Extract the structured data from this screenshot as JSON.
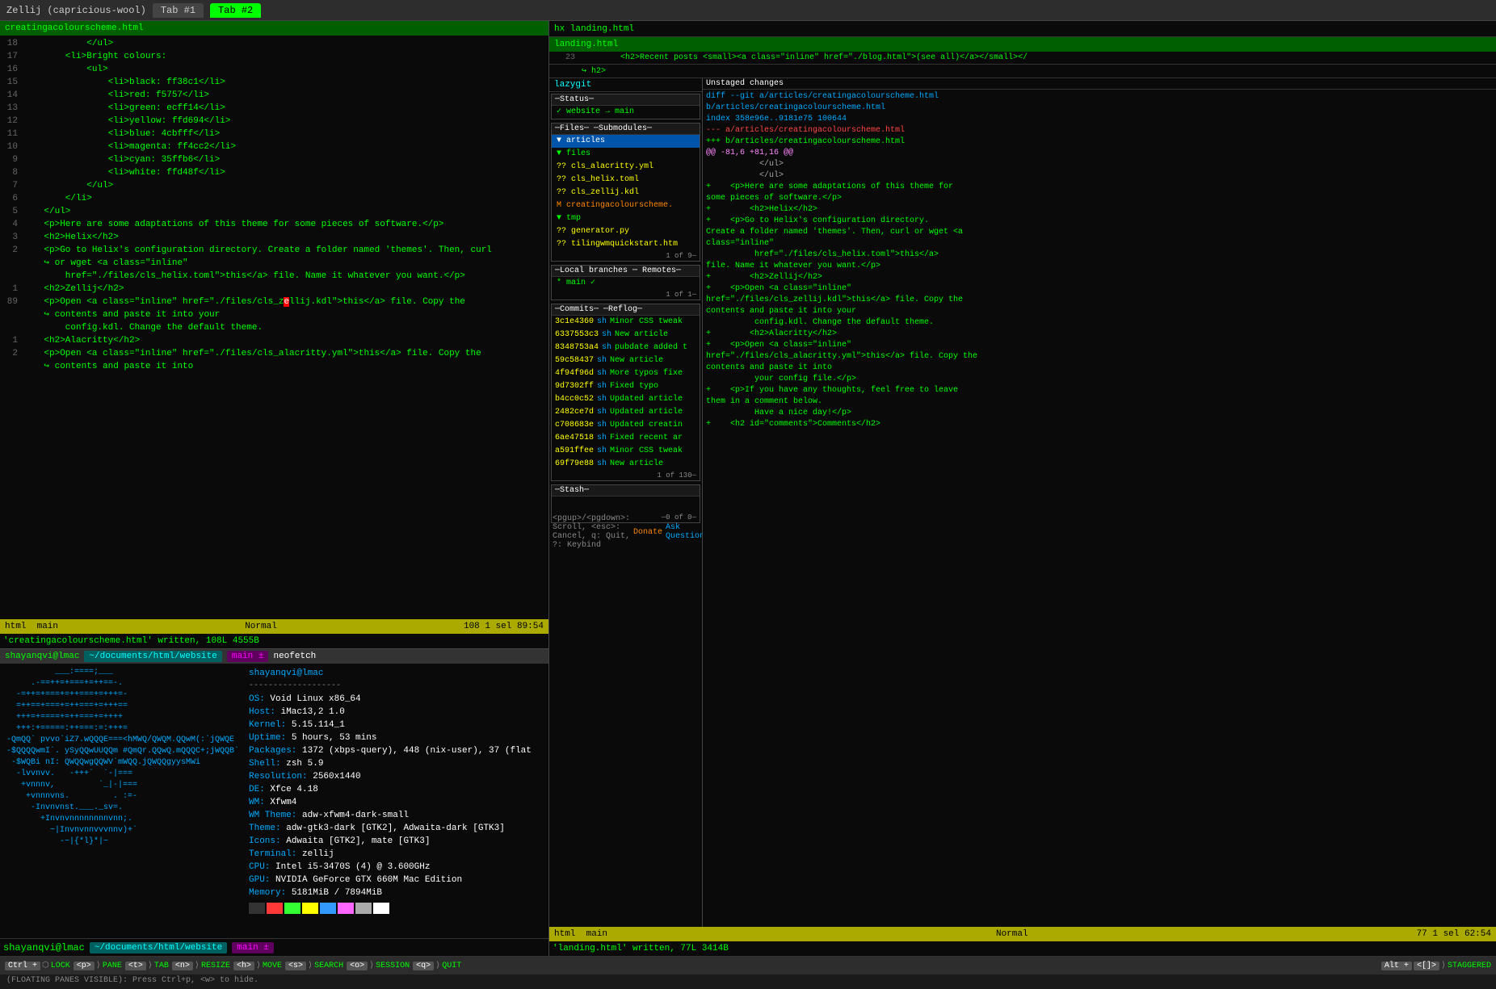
{
  "titleBar": {
    "title": "Zellij (capricious-wool)",
    "tab1": "Tab #1",
    "tab2": "Tab #2"
  },
  "leftEditor": {
    "filename": "creatingacolourscheme.html",
    "lines": [
      {
        "num": "18",
        "content": "            </ul>"
      },
      {
        "num": "17",
        "content": "        <li>Bright colours:"
      },
      {
        "num": "16",
        "content": "            <ul>"
      },
      {
        "num": "15",
        "content": "                <li>black: ff38c1</li>"
      },
      {
        "num": "14",
        "content": "                <li>red: f5757</li>"
      },
      {
        "num": "13",
        "content": "                <li>green: ecff14</li>"
      },
      {
        "num": "12",
        "content": "                <li>yellow: ffd694</li>"
      },
      {
        "num": "11",
        "content": "                <li>blue: 4cbfff</li>"
      },
      {
        "num": "10",
        "content": "                <li>magenta: ff4cc2</li>"
      },
      {
        "num": "9",
        "content": "                <li>cyan: 35ffb6</li>"
      },
      {
        "num": "8",
        "content": "                <li>white: ffd48f</li>"
      },
      {
        "num": "7",
        "content": "            </ul>"
      },
      {
        "num": "6",
        "content": "        </li>"
      },
      {
        "num": "5",
        "content": "    </ul>"
      },
      {
        "num": "4",
        "content": "    <p>Here are some adaptations of this theme for some pieces of software.</p>"
      },
      {
        "num": "3",
        "content": "    <h2>Helix</h2>"
      },
      {
        "num": "2",
        "content": "    <p>Go to Helix's configuration directory. Create a folder named 'themes'. Then, curl"
      },
      {
        "num": "",
        "content": "    ↪ or wget <a class=\"inline\""
      },
      {
        "num": "",
        "content": "        href=\"./files/cls_helix.toml\">this</a> file. Name it whatever you want.</p>"
      },
      {
        "num": "1",
        "content": "    <h2>Zellij</h2>"
      },
      {
        "num": "89",
        "content": "    <p>Open <a class=\"inline\" href=\"./files/cls_zellij.kdl\">this</a> file. Copy the"
      },
      {
        "num": "",
        "content": "    ↪ contents and paste it into your"
      },
      {
        "num": "",
        "content": "        config.kdl. Change the default theme."
      },
      {
        "num": "1",
        "content": "    <h2>Alacritty</h2>"
      },
      {
        "num": "2",
        "content": "    <p>Open <a class=\"inline\" href=\"./files/cls_alacritty.yml\">this</a> file. Copy the"
      },
      {
        "num": "",
        "content": "    ↪ contents and paste it into"
      }
    ],
    "statusbar": {
      "left": "html  main",
      "mode": "Normal",
      "right": "108  1 sel  89:54"
    },
    "cmdline": "'creatingacolourscheme.html' written, 108L 4555B"
  },
  "terminal": {
    "user": "shayanqvi@lmac",
    "path": "~/documents/html/website",
    "branch": "main ±",
    "command": "neofetch",
    "hostname": "shayanqvi@lmac",
    "info": {
      "os": "Void Linux x86_64",
      "host": "iMac13,2 1.0",
      "kernel": "5.15.114_1",
      "uptime": "5 hours, 53 mins",
      "packages": "1372 (xbps-query), 448 (nix-user), 37 (flat",
      "shell": "zsh 5.9",
      "resolution": "2560x1440",
      "de": "Xfce 4.18",
      "wm": "Xfwm4",
      "wm_theme": "adw-xfwm4-dark-small",
      "theme": "adw-gtk3-dark [GTK2], Adwaita-dark [GTK3]",
      "icons": "Adwaita [GTK2], mate [GTK3]",
      "terminal": "zellij",
      "cpu": "Intel i5-3470S (4) @ 3.600GHz",
      "gpu": "NVIDIA GeForce GTX 660M Mac Edition",
      "memory": "5181MiB / 7894MiB"
    },
    "swatches": [
      "#1a1a2e",
      "#333333",
      "#ff3838",
      "#33ff33",
      "#ffff00",
      "#3399ff",
      "#ff33ff",
      "#aaaaaa",
      "#ffffff"
    ]
  },
  "rightEditor": {
    "windowTitle": "hx landing.html",
    "filename": "landing.html",
    "headerLine": "      <h2>Recent posts <small><a class=\"inline\" href=\"./blog.html\">(see all)</a></small></",
    "lineNum": "23"
  },
  "lazygit": {
    "title": "lazygit",
    "statusSection": {
      "title": "Status",
      "item": "✓ website → main"
    },
    "filesSection": {
      "title": "Files",
      "submodulesTitle": "Submodules",
      "items": [
        {
          "name": "▼ articles",
          "selected": true
        },
        {
          "name": "  ▼ files",
          "type": "normal"
        },
        {
          "name": "    ?? cls_alacritty.yml",
          "type": "yellow"
        },
        {
          "name": "    ?? cls_helix.toml",
          "type": "yellow"
        },
        {
          "name": "    ?? cls_zellij.kdl",
          "type": "yellow"
        },
        {
          "name": "  M creatingacolourscheme.",
          "type": "modified"
        },
        {
          "name": "▼ tmp",
          "type": "normal"
        },
        {
          "name": "  ?? generator.py",
          "type": "yellow"
        },
        {
          "name": "  ?? tilingwmquickstart.htm",
          "type": "yellow"
        }
      ],
      "scrollIndicator": "1 of 9"
    },
    "branchesSection": {
      "title": "Local branches",
      "remotesTitle": "Remotes",
      "items": [
        {
          "name": "* main ✓",
          "selected": false
        }
      ],
      "scrollIndicator": "1 of 1"
    },
    "commitsSection": {
      "title": "Commits",
      "reflogTitle": "Reflog",
      "items": [
        {
          "hash": "3c1e4360",
          "author": "sh",
          "msg": "Minor CSS tweak"
        },
        {
          "hash": "6337553c3",
          "author": "sh",
          "msg": "New article"
        },
        {
          "hash": "8348753a4",
          "author": "sh",
          "msg": "pubdate added t"
        },
        {
          "hash": "59c58437",
          "author": "sh",
          "msg": "New article"
        },
        {
          "hash": "4f94f96d",
          "author": "sh",
          "msg": "More typos fixe"
        },
        {
          "hash": "9d7302ff",
          "author": "sh",
          "msg": "Fixed typo"
        },
        {
          "hash": "b4cc0c52",
          "author": "sh",
          "msg": "Updated article"
        },
        {
          "hash": "2482ce7d",
          "author": "sh",
          "msg": "Updated article"
        },
        {
          "hash": "c708683e",
          "author": "sh",
          "msg": "Updated creatin"
        },
        {
          "hash": "6ae47518",
          "author": "sh",
          "msg": "Fixed recent ar"
        },
        {
          "hash": "a591ffee",
          "author": "sh",
          "msg": "Minor CSS tweak"
        },
        {
          "hash": "69f79e88",
          "author": "sh",
          "msg": "New article"
        }
      ],
      "scrollIndicator": "1 of 130"
    },
    "stashSection": {
      "title": "Stash",
      "scrollIndicator": "0 of 0"
    }
  },
  "diffPanel": {
    "title": "Unstaged changes",
    "lines": [
      {
        "type": "meta",
        "text": "diff --git a/articles/creatingacolourscheme.html"
      },
      {
        "type": "meta",
        "text": "b/articles/creatingacolourscheme.html"
      },
      {
        "type": "meta",
        "text": "index 358e96e..9181e75 100644"
      },
      {
        "type": "removed",
        "text": "--- a/articles/creatingacolourscheme.html"
      },
      {
        "type": "added",
        "text": "+++ b/articles/creatingacolourscheme.html"
      },
      {
        "type": "header",
        "text": "@@ -81,6 +81,16 @@"
      },
      {
        "type": "normal",
        "text": "           </ul>"
      },
      {
        "type": "normal",
        "text": "           </ul>"
      },
      {
        "type": "added",
        "text": "+    <p>Here are some adaptations of this theme for"
      },
      {
        "type": "added",
        "text": "some pieces of software.</p>"
      },
      {
        "type": "added",
        "text": "+        <h2>Helix</h2>"
      },
      {
        "type": "added",
        "text": "+    <p>Go to Helix's configuration directory."
      },
      {
        "type": "added",
        "text": "Create a folder named 'themes'. Then, curl or wget <a"
      },
      {
        "type": "added",
        "text": "class=\"inline\""
      },
      {
        "type": "added",
        "text": "          href=\"./files/cls_helix.toml\">this</a>"
      },
      {
        "type": "added",
        "text": "file. Name it whatever you want.</p>"
      },
      {
        "type": "added",
        "text": "+        <h2>Zellij</h2>"
      },
      {
        "type": "added",
        "text": "+    <p>Open <a class=\"inline\""
      },
      {
        "type": "added",
        "text": "href=\"./files/cls_zellij.kdl\">this</a> file. Copy the"
      },
      {
        "type": "added",
        "text": "contents and paste it into your"
      },
      {
        "type": "added",
        "text": "          config.kdl. Change the default theme."
      },
      {
        "type": "added",
        "text": "+        <h2>Alacritty</h2>"
      },
      {
        "type": "added",
        "text": "+    <p>Open <a class=\"inline\""
      },
      {
        "type": "added",
        "text": "href=\"./files/cls_alacritty.yml\">this</a> file. Copy the"
      },
      {
        "type": "added",
        "text": "contents and paste it into"
      },
      {
        "type": "added",
        "text": "          your config file.</p>"
      },
      {
        "type": "added",
        "text": "+    <p>If you have any thoughts, feel free to leave"
      },
      {
        "type": "added",
        "text": "them in a comment below."
      },
      {
        "type": "added",
        "text": "          Have a nice day!</p>"
      },
      {
        "type": "added",
        "text": "+    <h2 id=\"comments\">Comments</h2>"
      }
    ]
  },
  "rightStatusbar": {
    "left": "html  main",
    "mode": "Normal",
    "right": "77  1 sel  62:54"
  },
  "rightCmdline": "'landing.html' written, 77L 3414B",
  "keybinds": [
    {
      "key": "Ctrl +",
      "arrow": "⬡",
      "label": "LOCK"
    },
    {
      "key": "<p>",
      "arrow": "⟩",
      "label": "PANE"
    },
    {
      "key": "<t>",
      "arrow": "⟩",
      "label": "TAB"
    },
    {
      "key": "<n>",
      "arrow": "⟩",
      "label": "RESIZE"
    },
    {
      "key": "<h>",
      "arrow": "⟩",
      "label": "MOVE"
    },
    {
      "key": "<s>",
      "arrow": "⟩",
      "label": "SEARCH"
    },
    {
      "key": "<o>",
      "arrow": "⟩",
      "label": "SESSION"
    },
    {
      "key": "<q>",
      "arrow": "⟩",
      "label": "QUIT"
    },
    {
      "key": "Alt +",
      "arrow": "",
      "label": "<[]>"
    },
    {
      "key": "",
      "arrow": "⟩",
      "label": "STAGGERED"
    }
  ],
  "hintLine": "(FLOATING PANES VISIBLE): Press Ctrl+p, <w> to hide."
}
